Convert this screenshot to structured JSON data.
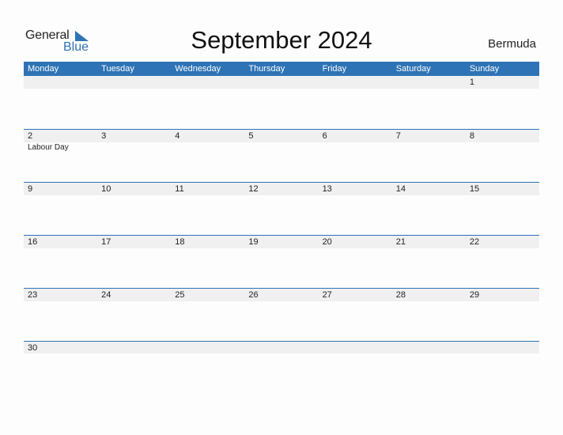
{
  "logo": {
    "general": "General",
    "blue": "Blue"
  },
  "title": "September 2024",
  "country": "Bermuda",
  "colors": {
    "accent": "#2e73b5",
    "strip": "#f0f0f0"
  },
  "weekdays": [
    "Monday",
    "Tuesday",
    "Wednesday",
    "Thursday",
    "Friday",
    "Saturday",
    "Sunday"
  ],
  "weeks": [
    {
      "days": [
        {
          "n": ""
        },
        {
          "n": ""
        },
        {
          "n": ""
        },
        {
          "n": ""
        },
        {
          "n": ""
        },
        {
          "n": ""
        },
        {
          "n": "1"
        }
      ]
    },
    {
      "days": [
        {
          "n": "2",
          "event": "Labour Day"
        },
        {
          "n": "3"
        },
        {
          "n": "4"
        },
        {
          "n": "5"
        },
        {
          "n": "6"
        },
        {
          "n": "7"
        },
        {
          "n": "8"
        }
      ]
    },
    {
      "days": [
        {
          "n": "9"
        },
        {
          "n": "10"
        },
        {
          "n": "11"
        },
        {
          "n": "12"
        },
        {
          "n": "13"
        },
        {
          "n": "14"
        },
        {
          "n": "15"
        }
      ]
    },
    {
      "days": [
        {
          "n": "16"
        },
        {
          "n": "17"
        },
        {
          "n": "18"
        },
        {
          "n": "19"
        },
        {
          "n": "20"
        },
        {
          "n": "21"
        },
        {
          "n": "22"
        }
      ]
    },
    {
      "days": [
        {
          "n": "23"
        },
        {
          "n": "24"
        },
        {
          "n": "25"
        },
        {
          "n": "26"
        },
        {
          "n": "27"
        },
        {
          "n": "28"
        },
        {
          "n": "29"
        }
      ]
    },
    {
      "days": [
        {
          "n": "30"
        },
        {
          "n": ""
        },
        {
          "n": ""
        },
        {
          "n": ""
        },
        {
          "n": ""
        },
        {
          "n": ""
        },
        {
          "n": ""
        }
      ]
    }
  ]
}
